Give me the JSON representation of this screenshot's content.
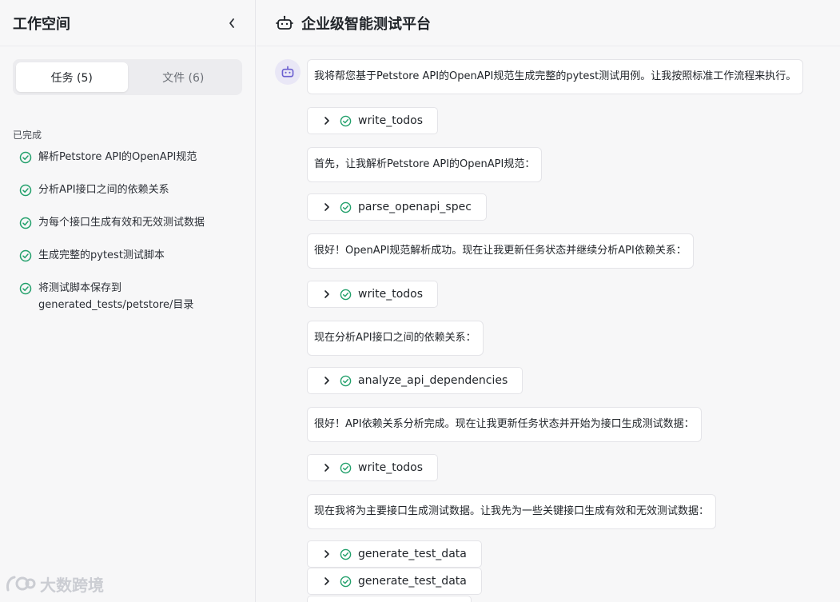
{
  "sidebar": {
    "title": "工作空间",
    "tabs": [
      {
        "label": "任务 (5)",
        "active": true
      },
      {
        "label": "文件 (6)",
        "active": false
      }
    ],
    "section_label": "已完成",
    "tasks": [
      {
        "label": "解析Petstore API的OpenAPI规范",
        "status": "completed"
      },
      {
        "label": "分析API接口之间的依赖关系",
        "status": "completed"
      },
      {
        "label": "为每个接口生成有效和无效测试数据",
        "status": "completed"
      },
      {
        "label": "生成完整的pytest测试脚本",
        "status": "completed"
      },
      {
        "label": "将测试脚本保存到 generated_tests/petstore/目录",
        "status": "completed"
      }
    ],
    "watermark": "大数跨境"
  },
  "main": {
    "title": "企业级智能测试平台",
    "feed": [
      {
        "type": "message",
        "text": "我将帮您基于Petstore API的OpenAPI规范生成完整的pytest测试用例。让我按照标准工作流程来执行。"
      },
      {
        "type": "tool",
        "name": "write_todos"
      },
      {
        "type": "message",
        "text": "首先，让我解析Petstore API的OpenAPI规范："
      },
      {
        "type": "tool",
        "name": "parse_openapi_spec"
      },
      {
        "type": "message",
        "text": "很好！OpenAPI规范解析成功。现在让我更新任务状态并继续分析API依赖关系："
      },
      {
        "type": "tool",
        "name": "write_todos"
      },
      {
        "type": "message",
        "text": "现在分析API接口之间的依赖关系："
      },
      {
        "type": "tool",
        "name": "analyze_api_dependencies"
      },
      {
        "type": "message",
        "text": "很好！API依赖关系分析完成。现在让我更新任务状态并开始为接口生成测试数据："
      },
      {
        "type": "tool",
        "name": "write_todos"
      },
      {
        "type": "message",
        "text": "现在我将为主要接口生成测试数据。让我先为一些关键接口生成有效和无效测试数据："
      },
      {
        "type": "tool",
        "name": "generate_test_data"
      },
      {
        "type": "tool",
        "name": "generate_test_data"
      }
    ]
  },
  "colors": {
    "success": "#22a06b",
    "avatar_bg": "#e9e7f6",
    "avatar_fg": "#6b5fd0"
  }
}
